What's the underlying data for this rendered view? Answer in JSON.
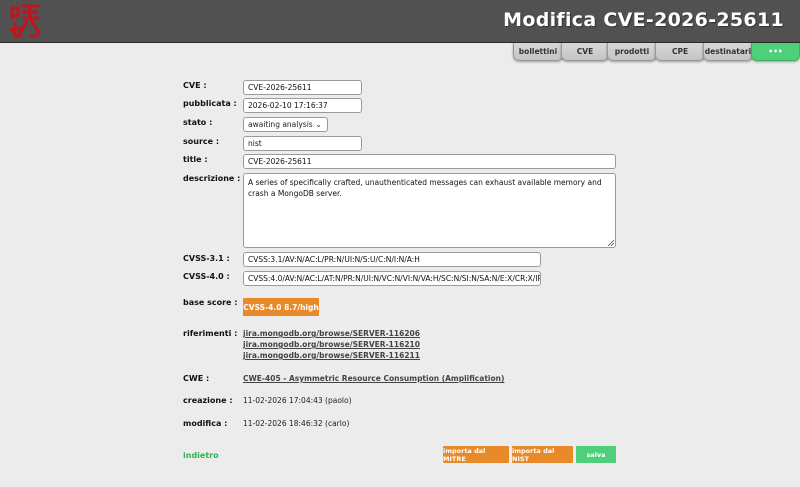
{
  "header": {
    "title": "Modifica CVE-2026-25611",
    "logo_icon": "calligraphy-logo-icon"
  },
  "tabs": [
    {
      "label": "bollettini"
    },
    {
      "label": "CVE"
    },
    {
      "label": "prodotti"
    },
    {
      "label": "CPE"
    },
    {
      "label": "destinatari"
    },
    {
      "label": "•••"
    }
  ],
  "form": {
    "cve": {
      "label": "CVE :",
      "value": "CVE-2026-25611"
    },
    "pubblicata": {
      "label": "pubblicata :",
      "value": "2026-02-10 17:16:37"
    },
    "stato": {
      "label": "stato :",
      "value": "awaiting analysis"
    },
    "source": {
      "label": "source :",
      "value": "nist"
    },
    "title": {
      "label": "title :",
      "value": "CVE-2026-25611"
    },
    "descrizione": {
      "label": "descrizione :",
      "value": "A series of specifically crafted, unauthenticated messages can exhaust available memory and crash a MongoDB server."
    },
    "cvss31": {
      "label": "CVSS-3.1 :",
      "value": "CVSS:3.1/AV:N/AC:L/PR:N/UI:N/S:U/C:N/I:N/A:H"
    },
    "cvss40": {
      "label": "CVSS-4.0 :",
      "value": "CVSS:4.0/AV:N/AC:L/AT:N/PR:N/UI:N/VC:N/VI:N/VA:H/SC:N/SI:N/SA:N/E:X/CR:X/IR:X/AI"
    },
    "base_score": {
      "label": "base score :",
      "value": "CVSS-4.0 8.7/high",
      "color": "#e8892a"
    },
    "riferimenti": {
      "label": "riferimenti :",
      "links": [
        "jira.mongodb.org/browse/SERVER-116206",
        "jira.mongodb.org/browse/SERVER-116210",
        "jira.mongodb.org/browse/SERVER-116211"
      ]
    },
    "cwe": {
      "label": "CWE :",
      "value": "CWE-405 - Asymmetric Resource Consumption (Amplification)"
    },
    "creazione": {
      "label": "creazione :",
      "value": "11-02-2026 17:04:43 (paolo)"
    },
    "modifica": {
      "label": "modifica :",
      "value": "11-02-2026 18:46:32 (carlo)"
    }
  },
  "footer": {
    "back": "indietro",
    "import_mitre": "importa dal MITRE",
    "import_nist": "importa dal NIST",
    "save": "salva"
  },
  "colors": {
    "accent_green": "#4fcf7a",
    "accent_orange": "#e8892a",
    "header_title_color": "#ffffff"
  }
}
